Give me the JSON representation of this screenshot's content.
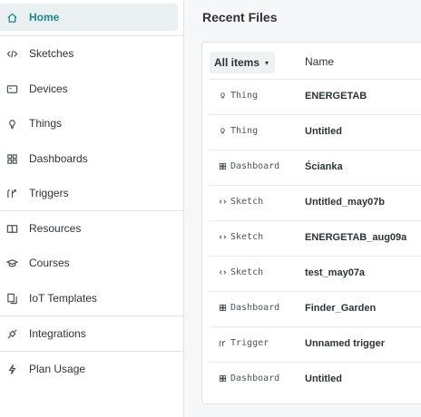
{
  "sidebar": {
    "items": [
      {
        "label": "Home",
        "icon": "home-icon",
        "active": true
      },
      {
        "label": "Sketches",
        "icon": "code-icon"
      },
      {
        "label": "Devices",
        "icon": "device-icon"
      },
      {
        "label": "Things",
        "icon": "thing-icon"
      },
      {
        "label": "Dashboards",
        "icon": "dashboard-icon"
      },
      {
        "label": "Triggers",
        "icon": "trigger-icon"
      },
      {
        "label": "Resources",
        "icon": "book-icon"
      },
      {
        "label": "Courses",
        "icon": "graduation-cap-icon"
      },
      {
        "label": "IoT Templates",
        "icon": "templates-icon"
      },
      {
        "label": "Integrations",
        "icon": "integrations-icon"
      },
      {
        "label": "Plan Usage",
        "icon": "lightning-icon"
      }
    ],
    "accent_color": "#1f8a8a"
  },
  "main": {
    "title": "Recent Files",
    "filter_label": "All items",
    "name_header": "Name",
    "rows": [
      {
        "type": "Thing",
        "name": "ENERGETAB"
      },
      {
        "type": "Thing",
        "name": "Untitled"
      },
      {
        "type": "Dashboard",
        "name": "Ścianka"
      },
      {
        "type": "Sketch",
        "name": "Untitled_may07b"
      },
      {
        "type": "Sketch",
        "name": "ENERGETAB_aug09a"
      },
      {
        "type": "Sketch",
        "name": "test_may07a"
      },
      {
        "type": "Dashboard",
        "name": "Finder_Garden"
      },
      {
        "type": "Trigger",
        "name": "Unnamed trigger"
      },
      {
        "type": "Dashboard",
        "name": "Untitled"
      }
    ]
  }
}
